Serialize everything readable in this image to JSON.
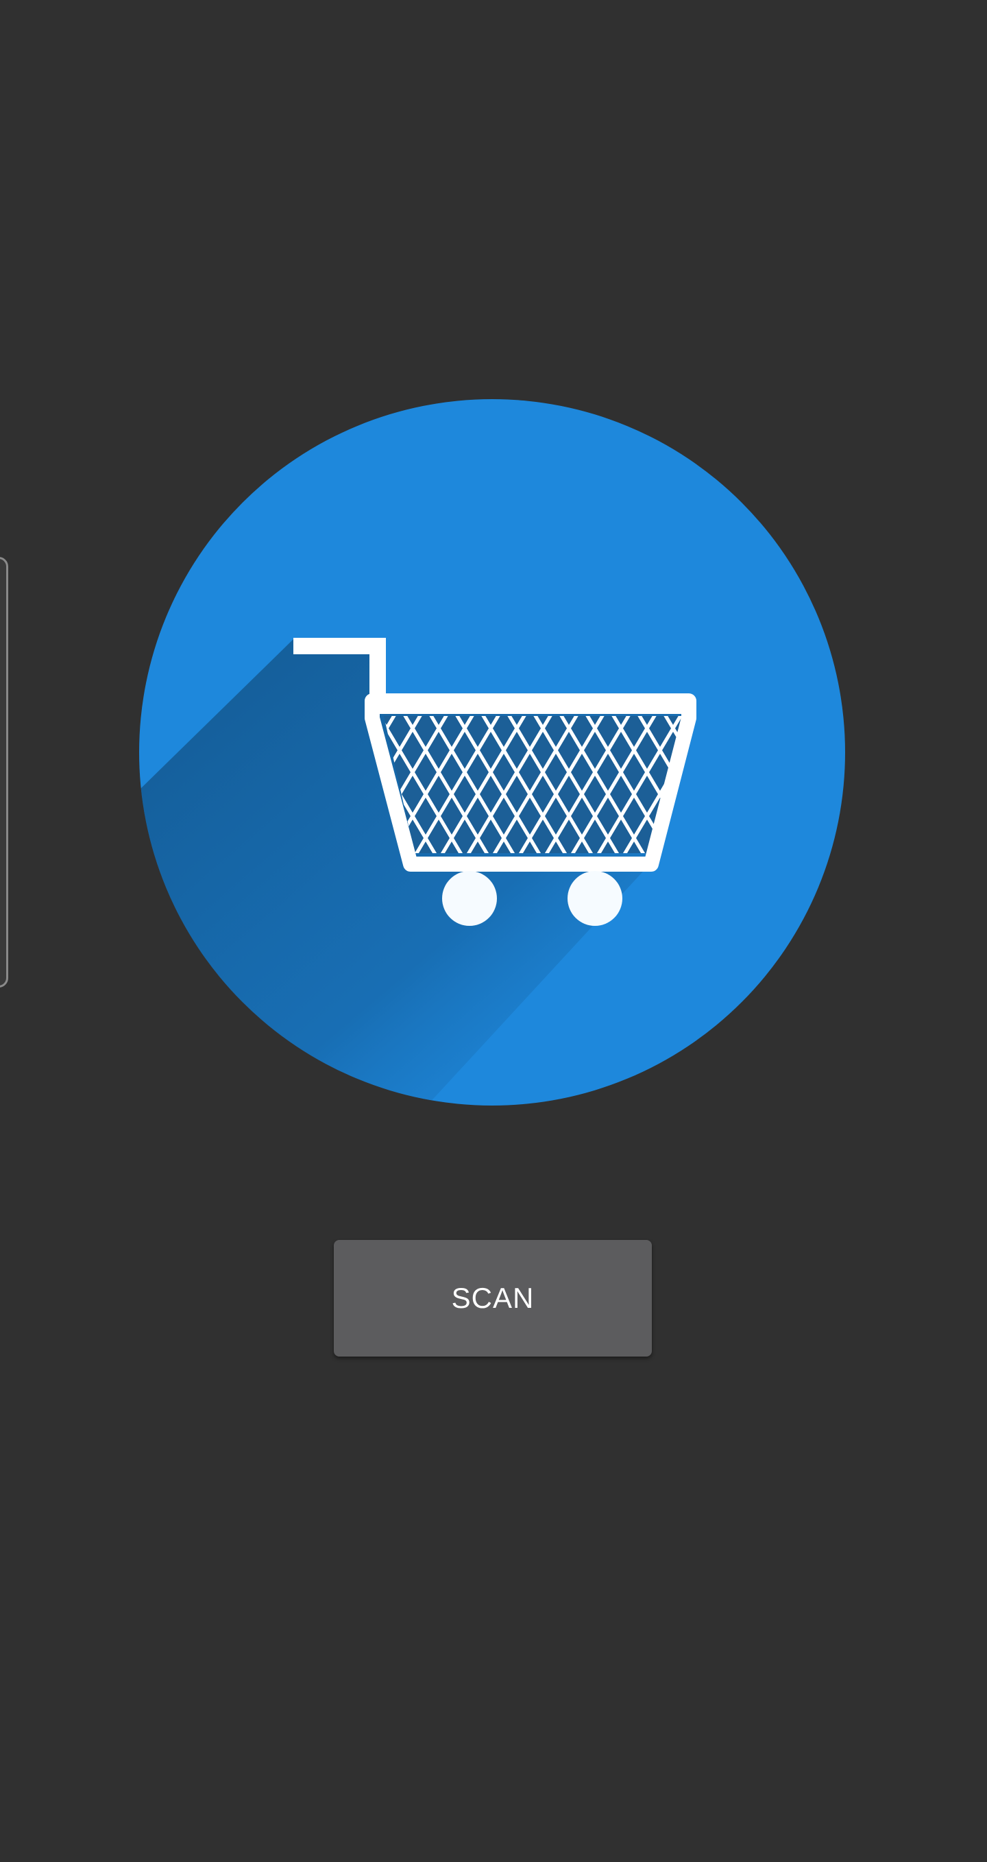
{
  "app": {
    "logo_icon": "shopping-cart-icon",
    "accent_color": "#1e88dc",
    "background_color": "#303030"
  },
  "scan_button": {
    "label": "SCAN",
    "background_color": "#5c5c5e"
  }
}
